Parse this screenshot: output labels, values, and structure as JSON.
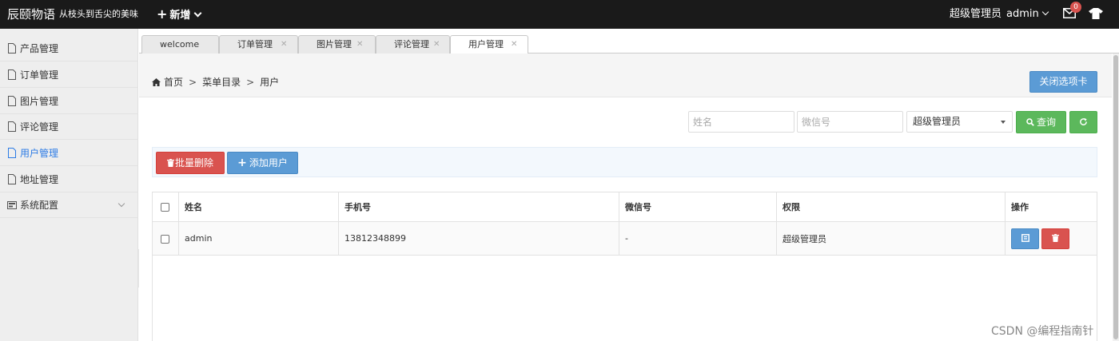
{
  "header": {
    "brand": "辰颐物语",
    "slogan": "从枝头到舌尖的美味",
    "new_label": "新增",
    "user_role": "超级管理员",
    "user_name": "admin",
    "mail_count": "0"
  },
  "sidebar": {
    "items": [
      {
        "label": "产品管理"
      },
      {
        "label": "订单管理"
      },
      {
        "label": "图片管理"
      },
      {
        "label": "评论管理"
      },
      {
        "label": "用户管理"
      },
      {
        "label": "地址管理"
      },
      {
        "label": "系统配置"
      }
    ]
  },
  "tabs": [
    {
      "label": "welcome"
    },
    {
      "label": "订单管理"
    },
    {
      "label": "图片管理"
    },
    {
      "label": "评论管理"
    },
    {
      "label": "用户管理"
    }
  ],
  "breadcrumb": {
    "home": "首页",
    "sep": ">",
    "level1": "菜单目录",
    "level2": "用户"
  },
  "close_tabs_label": "关闭选项卡",
  "search": {
    "name_placeholder": "姓名",
    "wechat_placeholder": "微信号",
    "role_selected": "超级管理员",
    "query_label": "查询"
  },
  "toolbar": {
    "batch_delete_label": "批量删除",
    "add_user_label": "添加用户"
  },
  "table": {
    "headers": [
      "姓名",
      "手机号",
      "微信号",
      "权限",
      "操作"
    ],
    "rows": [
      {
        "name": "admin",
        "phone": "13812348899",
        "wechat": "-",
        "role": "超级管理员"
      }
    ]
  },
  "watermark": "CSDN @编程指南针",
  "colors": {
    "navbar": "#1a1a1a",
    "primary_blue": "#5b9bd5",
    "success_green": "#5cb85c",
    "danger_red": "#d9534f",
    "active_link": "#2c7be5"
  }
}
